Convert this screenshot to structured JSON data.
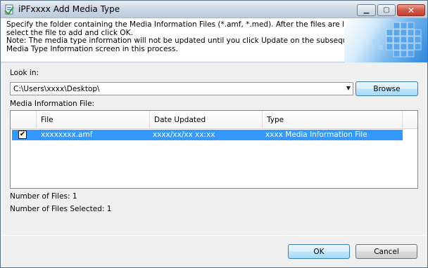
{
  "window": {
    "title": "iPFxxxx Add Media Type",
    "controls": {
      "minimize": "▁",
      "maximize": "▢",
      "close": "✕"
    }
  },
  "header": {
    "lines": [
      "Specify the folder containing the Media Information Files (*.amf, *.med). After the files are listed,",
      "select the file to add and click OK.",
      "Note: The media type information will not be updated until you click Update on the subsequent Edit",
      "Media Type Information screen in this process."
    ]
  },
  "look_in": {
    "label": "Look in:",
    "value": "C:\\Users\\xxxx\\Desktop\\",
    "dropdown_arrow": "▼",
    "browse_label": "Browse"
  },
  "media_list": {
    "label": "Media Information File:",
    "columns": [
      "File",
      "Date Updated",
      "Type"
    ],
    "rows": [
      {
        "checked": "✔",
        "file": "xxxxxxxx.amf",
        "date_updated": "xxxx/xx/xx xx:xx",
        "type": "xxxx Media Information File"
      }
    ]
  },
  "counts": {
    "files": "Number of Files: 1",
    "selected": "Number of Files Selected: 1"
  },
  "footer": {
    "ok_label": "OK",
    "cancel_label": "Cancel"
  }
}
